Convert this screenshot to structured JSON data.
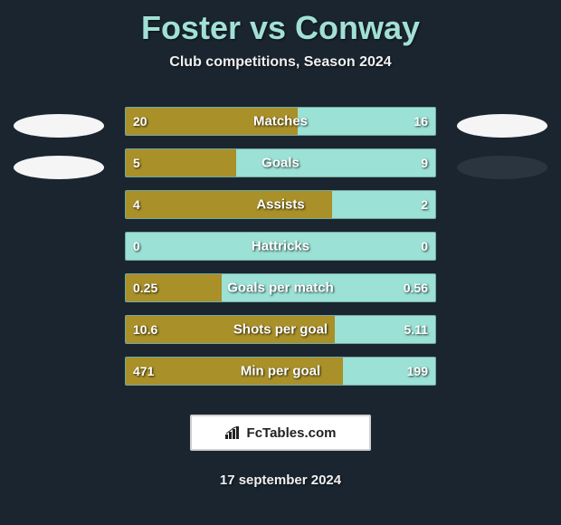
{
  "header": {
    "title": "Foster vs Conway",
    "subtitle": "Club competitions, Season 2024"
  },
  "players": {
    "left": "Foster",
    "right": "Conway"
  },
  "stats": [
    {
      "label": "Matches",
      "left": "20",
      "right": "16",
      "left_pct": 55.6
    },
    {
      "label": "Goals",
      "left": "5",
      "right": "9",
      "left_pct": 35.7
    },
    {
      "label": "Assists",
      "left": "4",
      "right": "2",
      "left_pct": 66.7
    },
    {
      "label": "Hattricks",
      "left": "0",
      "right": "0",
      "left_pct": 0
    },
    {
      "label": "Goals per match",
      "left": "0.25",
      "right": "0.56",
      "left_pct": 30.9
    },
    {
      "label": "Shots per goal",
      "left": "10.6",
      "right": "5.11",
      "left_pct": 67.5
    },
    {
      "label": "Min per goal",
      "left": "471",
      "right": "199",
      "left_pct": 70.3
    }
  ],
  "branding": {
    "text": "FcTables.com"
  },
  "footer": {
    "date": "17 september 2024"
  },
  "colors": {
    "left_bar": "#a99028",
    "right_bar": "#9be1d5",
    "accent": "#a2e0d6",
    "bg": "#1a2530"
  },
  "chart_data": {
    "type": "bar",
    "title": "Foster vs Conway — Club competitions, Season 2024",
    "series": [
      {
        "name": "Foster",
        "values": [
          20,
          5,
          4,
          0,
          0.25,
          10.6,
          471
        ]
      },
      {
        "name": "Conway",
        "values": [
          16,
          9,
          2,
          0,
          0.56,
          5.11,
          199
        ]
      }
    ],
    "categories": [
      "Matches",
      "Goals",
      "Assists",
      "Hattricks",
      "Goals per match",
      "Shots per goal",
      "Min per goal"
    ],
    "xlabel": "",
    "ylabel": ""
  }
}
